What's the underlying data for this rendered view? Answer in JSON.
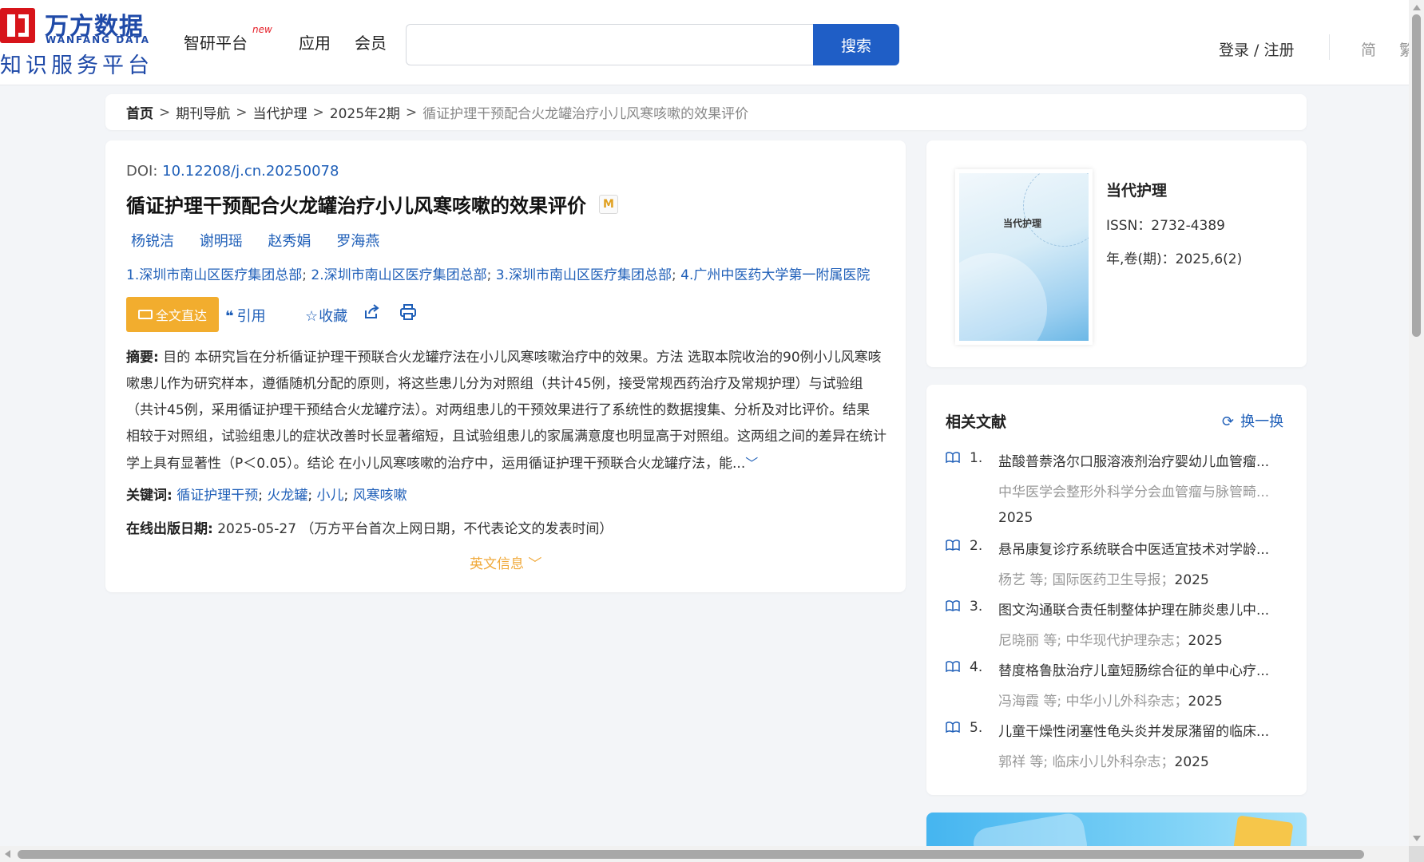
{
  "header": {
    "logo": {
      "cn": "万方数据",
      "en": "WANFANG DATA",
      "tagline": "知识服务平台"
    },
    "nav": [
      {
        "label": "智研平台",
        "badge": "new"
      },
      {
        "label": "应用"
      },
      {
        "label": "会员"
      }
    ],
    "search": {
      "placeholder": "",
      "button": "搜索"
    },
    "login": "登录 / 注册",
    "lang_simplified": "简",
    "lang_traditional": "繁"
  },
  "breadcrumb": {
    "items": [
      "首页",
      "期刊导航",
      "当代护理",
      "2025年2期"
    ],
    "separator": ">",
    "current": "循证护理干预配合火龙罐治疗小儿风寒咳嗽的效果评价"
  },
  "article": {
    "doi_label": "DOI:",
    "doi": "10.12208/j.cn.20250078",
    "title": "循证护理干预配合火龙罐治疗小儿风寒咳嗽的效果评价",
    "m_badge": "M",
    "authors": [
      "杨锐洁",
      "谢明瑶",
      "赵秀娟",
      "罗海燕"
    ],
    "affiliations": [
      "1.深圳市南山区医疗集团总部",
      "2.深圳市南山区医疗集团总部",
      "3.深圳市南山区医疗集团总部",
      "4.广州中医药大学第一附属医院"
    ],
    "affiliation_sep": ";",
    "fulltext_button": "全文直达",
    "cite": "引用",
    "favorite": "收藏",
    "abstract_label": "摘要:",
    "abstract": "目的 本研究旨在分析循证护理干预联合火龙罐疗法在小儿风寒咳嗽治疗中的效果。方法 选取本院收治的90例小儿风寒咳嗽患儿作为研究样本，遵循随机分配的原则，将这些患儿分为对照组（共计45例，接受常规西药治疗及常规护理）与试验组（共计45例，采用循证护理干预结合火龙罐疗法）。对两组患儿的干预效果进行了系统性的数据搜集、分析及对比评价。结果 相较于对照组，试验组患儿的症状改善时长显著缩短，且试验组患儿的家属满意度也明显高于对照组。这两组之间的差异在统计学上具有显著性（P＜0.05）。结论 在小儿风寒咳嗽的治疗中，运用循证护理干预联合火龙罐疗法，能...",
    "keywords_label": "关键词:",
    "keywords": [
      "循证护理干预",
      "火龙罐",
      "小儿",
      "风寒咳嗽"
    ],
    "keyword_sep": ";",
    "pubdate_label": "在线出版日期:",
    "pubdate": "2025-05-27",
    "pubdate_note": "（万方平台首次上网日期，不代表论文的发表时间）",
    "english_info": "英文信息"
  },
  "journal": {
    "cover_title": "当代护理",
    "name": "当代护理",
    "issn": "ISSN：2732-4389",
    "volume": "年,卷(期)：2025,6(2)"
  },
  "related": {
    "title": "相关文献",
    "refresh": "换一换",
    "items": [
      {
        "num": "1.",
        "title": "盐酸普萘洛尔口服溶液剂治疗婴幼儿血管瘤...",
        "meta": "中华医学会整形外科学分会血管瘤与脉管畸...",
        "year": "2025"
      },
      {
        "num": "2.",
        "title": "悬吊康复诊疗系统联合中医适宜技术对学龄...",
        "meta": "杨艺 等; 国际医药卫生导报；",
        "year": "2025"
      },
      {
        "num": "3.",
        "title": "图文沟通联合责任制整体护理在肺炎患儿中...",
        "meta": "尼晓丽 等; 中华现代护理杂志；",
        "year": "2025"
      },
      {
        "num": "4.",
        "title": "替度格鲁肽治疗儿童短肠综合征的单中心疗...",
        "meta": "冯海霞 等; 中华小儿外科杂志；",
        "year": "2025"
      },
      {
        "num": "5.",
        "title": "儿童干燥性闭塞性龟头炎并发尿潴留的临床...",
        "meta": "郭祥 等; 临床小儿外科杂志；",
        "year": "2025"
      }
    ]
  },
  "colors": {
    "brand_blue": "#1f5ec6",
    "link": "#1f5fb8",
    "accent_orange": "#f2ad2e",
    "logo_red": "#d7141a"
  }
}
